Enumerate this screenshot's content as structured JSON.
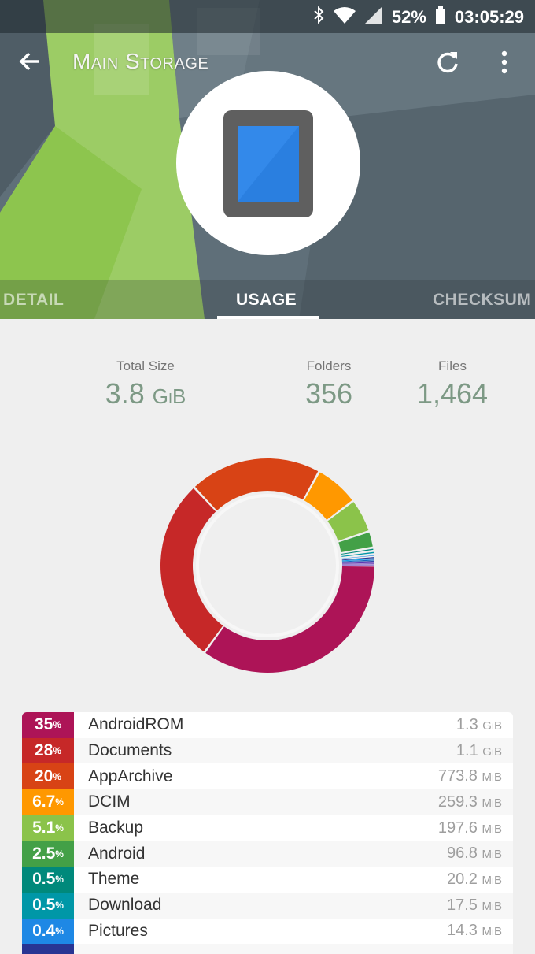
{
  "status_bar": {
    "battery": "52%",
    "time": "03:05:29"
  },
  "toolbar": {
    "title": "Main Storage"
  },
  "tabs": [
    {
      "label": "DETAIL"
    },
    {
      "label": "USAGE",
      "selected": true
    },
    {
      "label": "CHECKSUM"
    }
  ],
  "stats": {
    "total_size_label": "Total Size",
    "total_size_value": "3.8",
    "total_size_unit": "GiB",
    "folders_label": "Folders",
    "folders_value": "356",
    "files_label": "Files",
    "files_value": "1,464"
  },
  "items": [
    {
      "pct": "35",
      "name": "AndroidROM",
      "size": "1.3",
      "unit": "GiB",
      "color": "#ad1457"
    },
    {
      "pct": "28",
      "name": "Documents",
      "size": "1.1",
      "unit": "GiB",
      "color": "#c62828"
    },
    {
      "pct": "20",
      "name": "AppArchive",
      "size": "773.8",
      "unit": "MiB",
      "color": "#d84315"
    },
    {
      "pct": "6.7",
      "name": "DCIM",
      "size": "259.3",
      "unit": "MiB",
      "color": "#ff9800"
    },
    {
      "pct": "5.1",
      "name": "Backup",
      "size": "197.6",
      "unit": "MiB",
      "color": "#8bc34a"
    },
    {
      "pct": "2.5",
      "name": "Android",
      "size": "96.8",
      "unit": "MiB",
      "color": "#43a047"
    },
    {
      "pct": "0.5",
      "name": "Theme",
      "size": "20.2",
      "unit": "MiB",
      "color": "#00897b"
    },
    {
      "pct": "0.5",
      "name": "Download",
      "size": "17.5",
      "unit": "MiB",
      "color": "#0097a7"
    },
    {
      "pct": "0.4",
      "name": "Pictures",
      "size": "14.3",
      "unit": "MiB",
      "color": "#1e88e5"
    },
    {
      "pct": "",
      "name": "",
      "size": "",
      "unit": "",
      "color": "#283593"
    }
  ],
  "donut_extra_colors": [
    "#039be5",
    "#1565c0",
    "#3949ab",
    "#5e35b1",
    "#7e57c2",
    "#9575cd"
  ]
}
